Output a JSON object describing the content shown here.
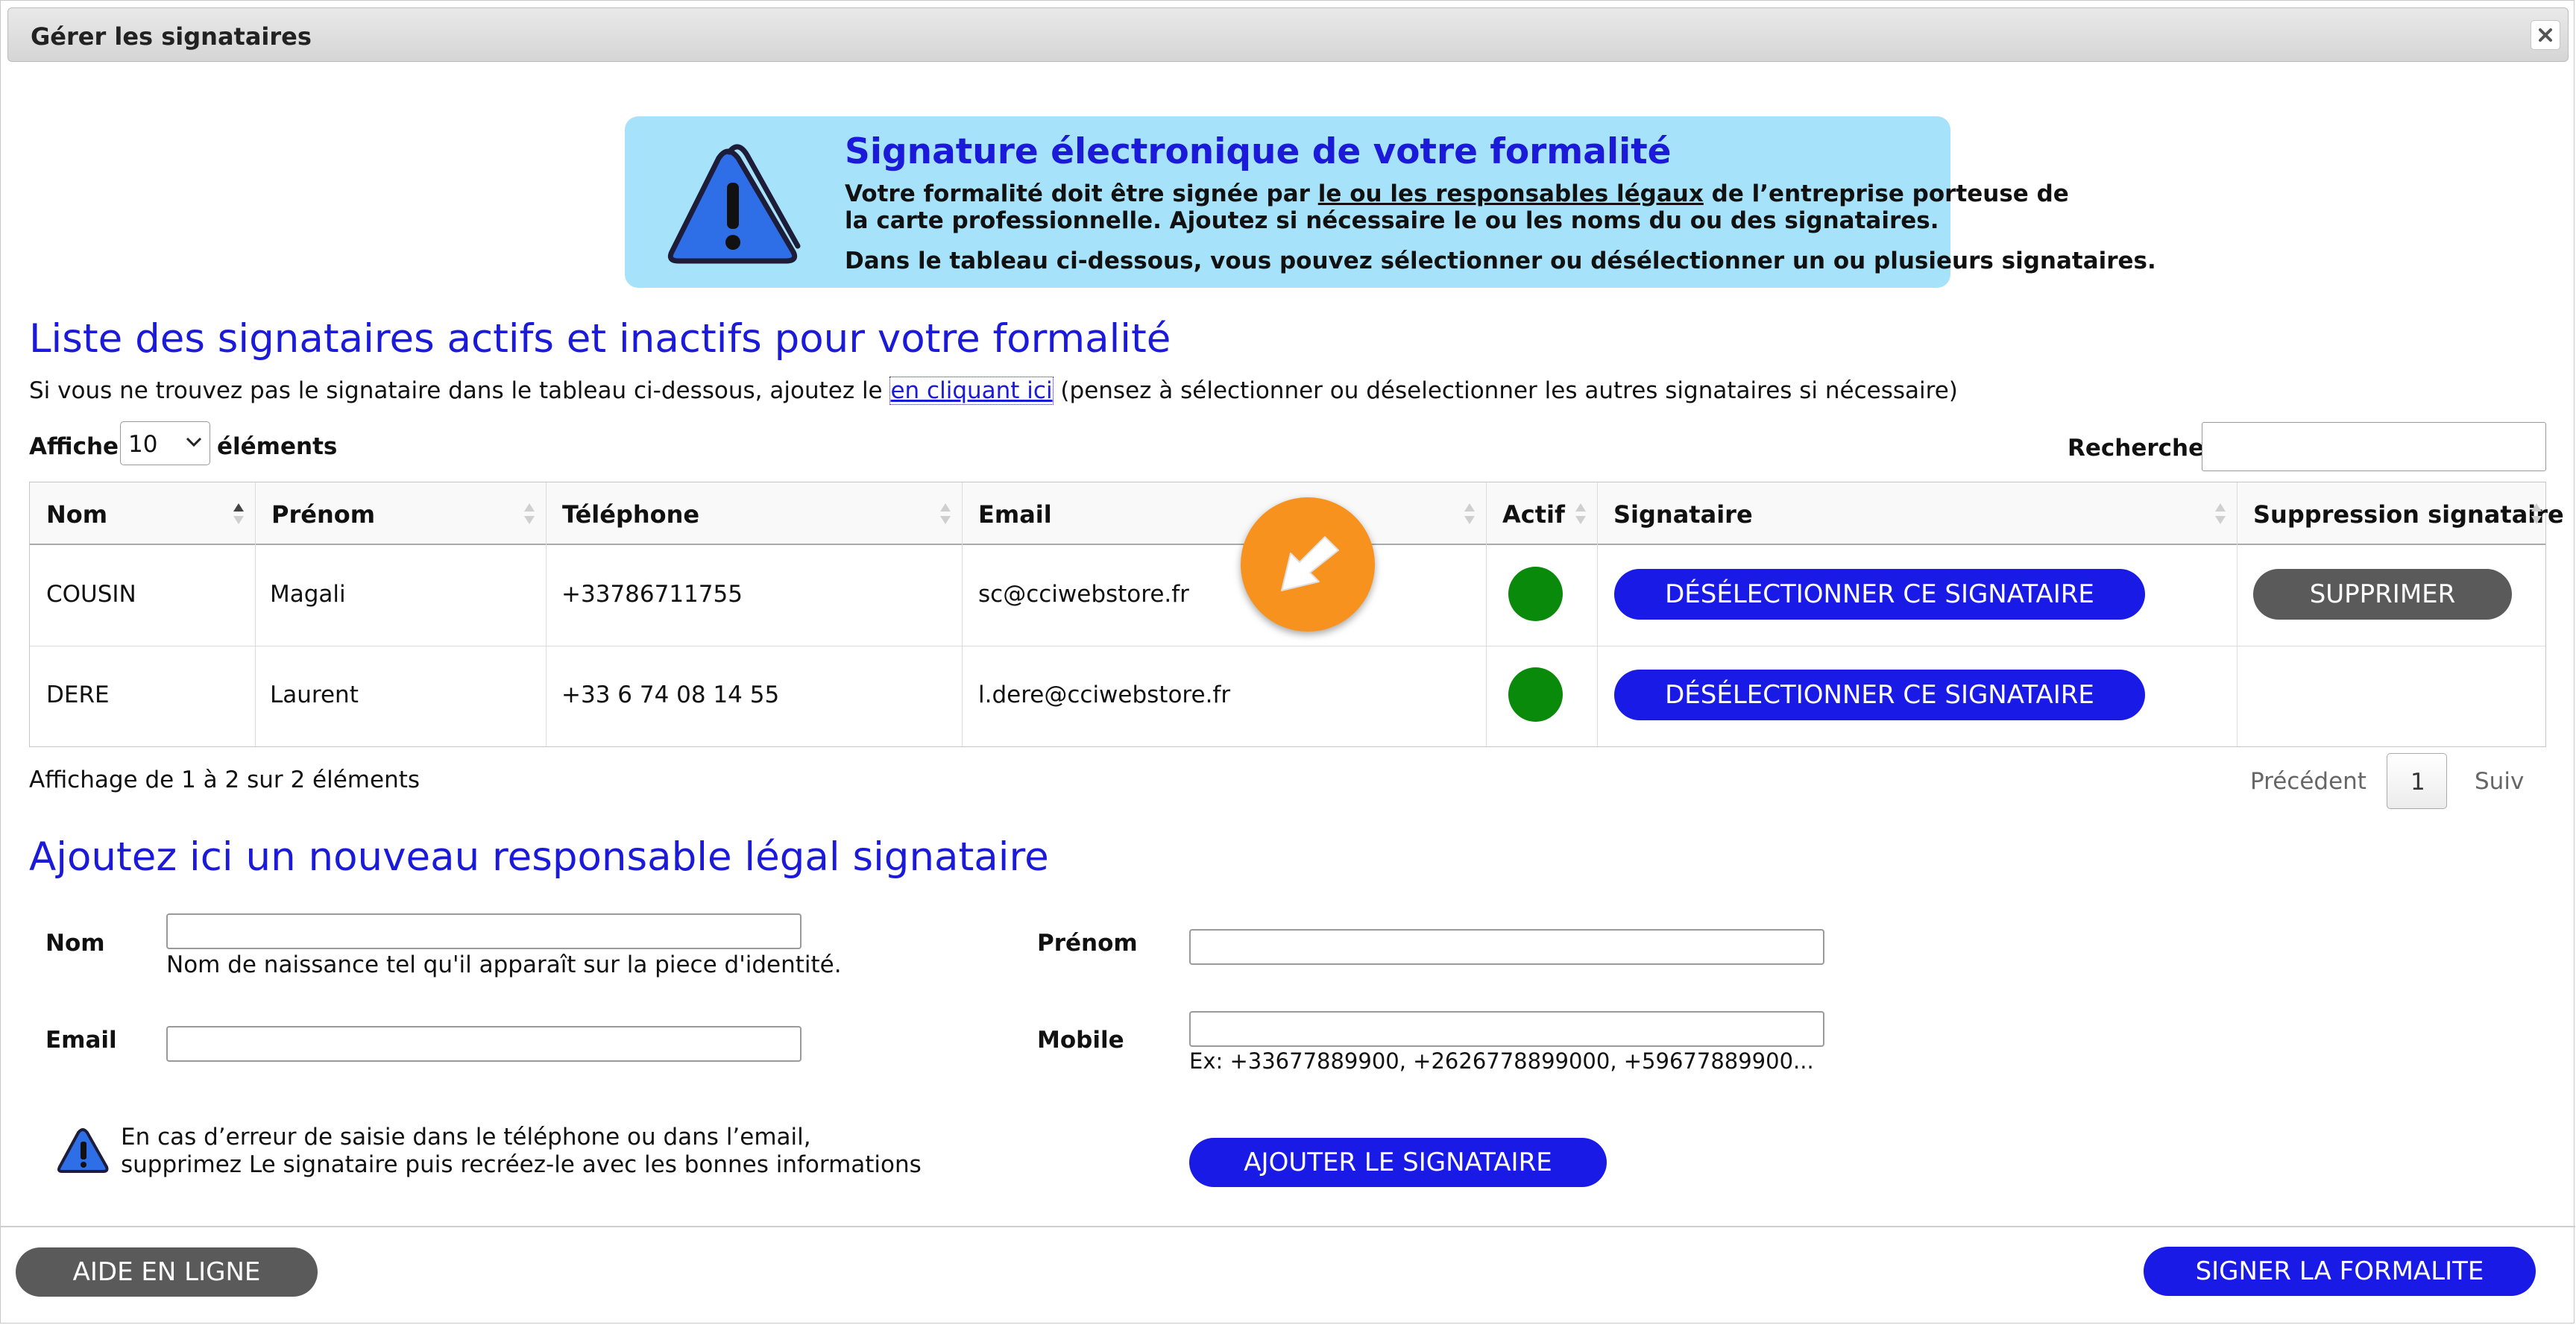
{
  "dialog": {
    "title": "Gérer les signataires"
  },
  "alert": {
    "title": "Signature électronique de votre formalité",
    "line1_before": "Votre formalité doit être signée par ",
    "line1_link": "le ou les responsables légaux",
    "line1_after": " de l’entreprise porteuse de",
    "line2": "la carte professionnelle. Ajoutez si nécessaire le ou les noms du ou des signataires.",
    "line3": "Dans le tableau ci-dessous, vous pouvez sélectionner ou désélectionner un ou plusieurs signataires."
  },
  "list": {
    "heading": "Liste des signataires actifs et inactifs pour votre formalité",
    "intro_before": "Si vous ne trouvez pas le signataire dans le tableau ci-dessous, ajoutez le ",
    "intro_link": "en cliquant ici",
    "intro_after": " (pensez à sélectionner ou déselectionner les autres signataires si nécessaire)",
    "show_label": "Afficher",
    "page_size": "10",
    "elements_label": "éléments",
    "search_label": "Rechercher:",
    "search_value": "",
    "columns": [
      "Nom",
      "Prénom",
      "Téléphone",
      "Email",
      "Actif",
      "Signataire",
      "Suppression signataire"
    ],
    "rows": [
      {
        "nom": "COUSIN",
        "prenom": "Magali",
        "telephone": "+33786711755",
        "email": "sc@cciwebstore.fr",
        "actif": true,
        "sign_label": "DÉSÉLECTIONNER CE SIGNATAIRE",
        "delete_label": "SUPPRIMER"
      },
      {
        "nom": "DERE",
        "prenom": "Laurent",
        "telephone": "+33 6 74 08 14 55",
        "email": "l.dere@cciwebstore.fr",
        "actif": true,
        "sign_label": "DÉSÉLECTIONNER CE SIGNATAIRE",
        "delete_label": ""
      }
    ],
    "info": "Affichage de 1 à 2 sur 2 éléments",
    "prev_label": "Précédent",
    "current_page": "1",
    "next_label": "Suiv"
  },
  "form": {
    "heading": "Ajoutez ici un nouveau responsable légal signataire",
    "nom_label": "Nom",
    "nom_help": "Nom de naissance tel qu'il apparaît sur la piece d'identité.",
    "prenom_label": "Prénom",
    "email_label": "Email",
    "mobile_label": "Mobile",
    "mobile_help": "Ex: +33677889900, +2626778899000, +59677889900...",
    "warning_line1": "En cas d’erreur de saisie dans le téléphone ou dans l’email,",
    "warning_line2": "supprimez Le signataire puis recréez-le avec les bonnes informations",
    "add_button": "AJOUTER LE SIGNATAIRE"
  },
  "footer": {
    "help_button": "AIDE EN LIGNE",
    "sign_button": "SIGNER LA FORMALITE"
  },
  "colors": {
    "accent_blue": "#1a1ae6",
    "heading_blue": "#1a1ad8",
    "alert_bg": "#a6e3fb",
    "active_green": "#0a8a0a",
    "grey_button": "#5a5a5a",
    "cursor_orange": "#f7921e"
  },
  "icons": [
    "close-icon",
    "warning-triangle-icon",
    "chevron-down-icon",
    "sort-icon",
    "cursor-arrow-icon"
  ]
}
